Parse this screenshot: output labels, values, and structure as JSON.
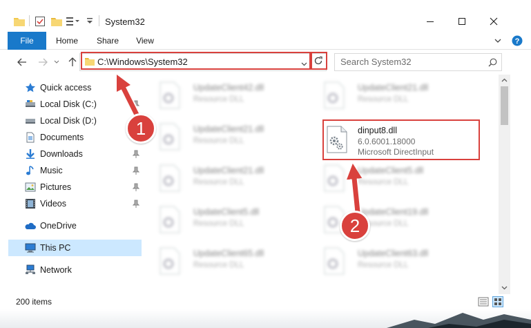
{
  "window": {
    "title": "System32"
  },
  "ribbon": {
    "tabs": [
      {
        "label": "File"
      },
      {
        "label": "Home"
      },
      {
        "label": "Share"
      },
      {
        "label": "View"
      }
    ]
  },
  "address_bar": {
    "path": "C:\\Windows\\System32"
  },
  "search": {
    "placeholder": "Search System32"
  },
  "sidebar": {
    "items": [
      {
        "label": "Quick access",
        "icon": "star-icon"
      },
      {
        "label": "Local Disk (C:)",
        "icon": "drive-icon"
      },
      {
        "label": "Local Disk (D:)",
        "icon": "drive-icon"
      },
      {
        "label": "Documents",
        "icon": "documents-icon"
      },
      {
        "label": "Downloads",
        "icon": "download-icon"
      },
      {
        "label": "Music",
        "icon": "music-icon"
      },
      {
        "label": "Pictures",
        "icon": "pictures-icon"
      },
      {
        "label": "Videos",
        "icon": "videos-icon"
      },
      {
        "label": "OneDrive",
        "icon": "cloud-icon"
      },
      {
        "label": "This PC",
        "icon": "pc-icon"
      },
      {
        "label": "Network",
        "icon": "network-icon"
      }
    ]
  },
  "files": [
    {
      "name": "UpdateClient42.dll",
      "type": "Resource DLL"
    },
    {
      "name": "UpdateClient21.dll",
      "type": "Resource DLL"
    },
    {
      "name": "UpdateClient21.dll",
      "type": "Resource DLL"
    },
    {
      "name": "dinput8.dll",
      "version": "6.0.6001.18000",
      "description": "Microsoft DirectInput"
    },
    {
      "name": "UpdateClient21.dll",
      "type": "Resource DLL"
    },
    {
      "name": "UpdateClient5.dll",
      "type": "Resource DLL"
    },
    {
      "name": "UpdateClient5.dll",
      "type": "Resource DLL"
    },
    {
      "name": "UpdateClient19.dll",
      "type": "Resource DLL"
    },
    {
      "name": "UpdateClient65.dll",
      "type": "Resource DLL"
    },
    {
      "name": "UpdateClient63.dll",
      "type": "Resource DLL"
    }
  ],
  "status": {
    "item_count": "200 items"
  },
  "annotations": {
    "step1": "1",
    "step2": "2",
    "highlight_color": "#d9413d"
  },
  "colors": {
    "accent": "#1979ca",
    "selected": "#cce8ff"
  }
}
